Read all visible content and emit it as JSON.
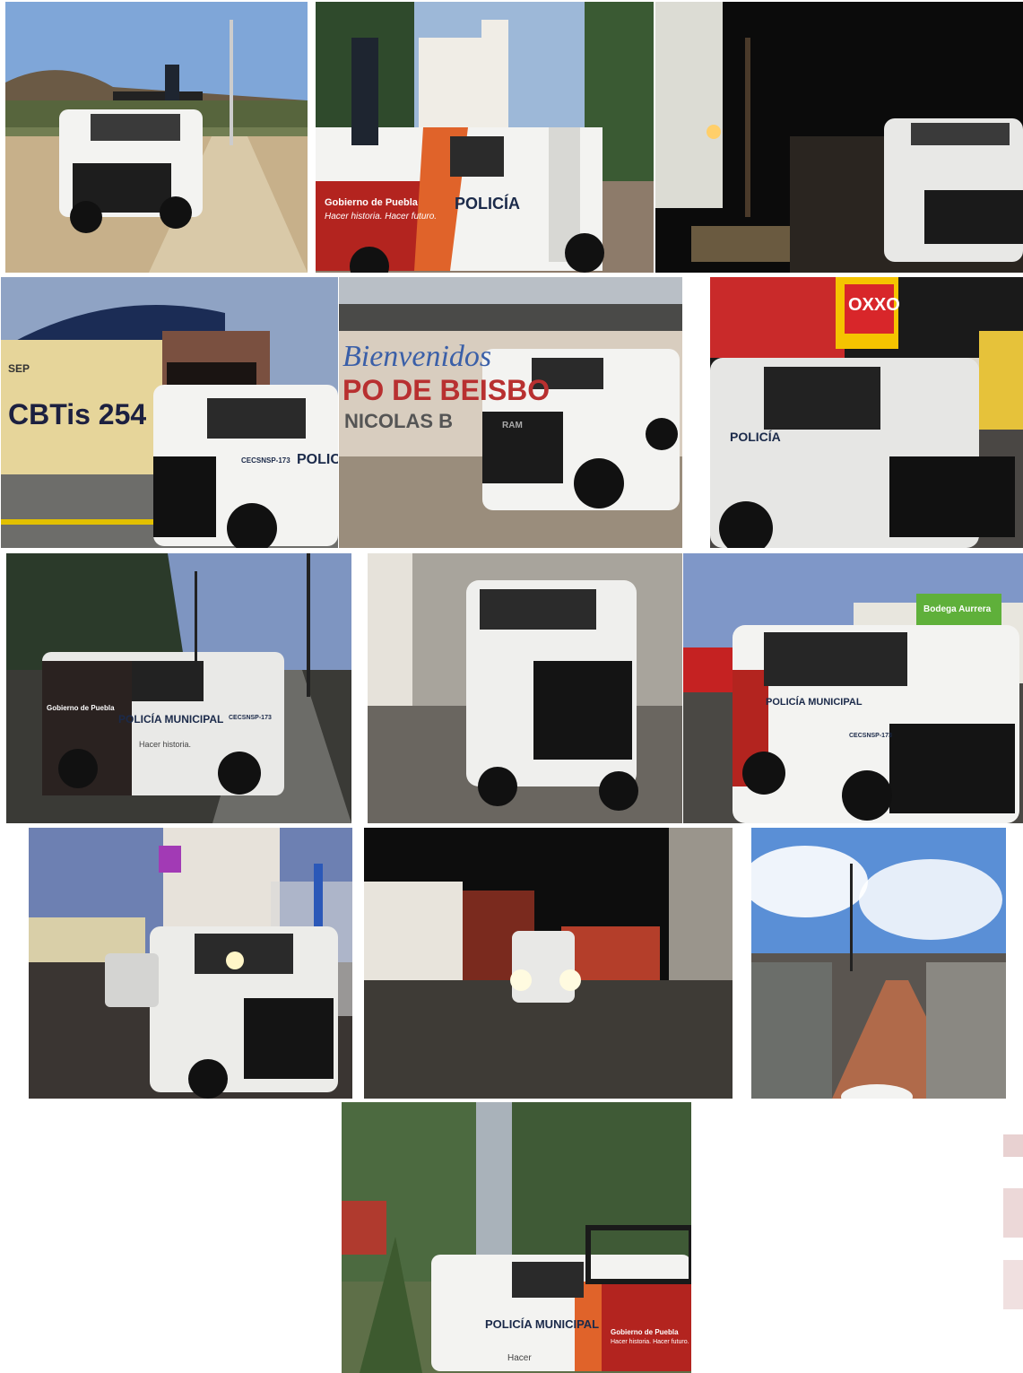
{
  "collage": {
    "photo_count": 14,
    "visible_text": {
      "puebla_gov": "Gobierno de Puebla",
      "slogan": "Hacer historia. Hacer futuro.",
      "slogan_short": "Hacer",
      "policia": "POLICÍA",
      "policia_municipal": "POLICÍA MUNICIPAL",
      "hacer_historia": "Hacer historia.",
      "unit_number": "CECSNSP-173",
      "school_name": "CBTis 254",
      "sep": "SEP",
      "wall_welcome": "Bienvenidos",
      "wall_line2": "PO DE BEISBO",
      "wall_line3": "NICOLAS B",
      "store_oxxo": "OXXO",
      "store_aurrera": "Bodega Aurrera",
      "ram": "RAM"
    },
    "colors": {
      "police_red": "#b3241f",
      "police_orange": "#e0632a",
      "truck_white": "#f3f3f1",
      "oxxo_red": "#d8262a",
      "oxxo_yellow": "#f5c400"
    }
  }
}
